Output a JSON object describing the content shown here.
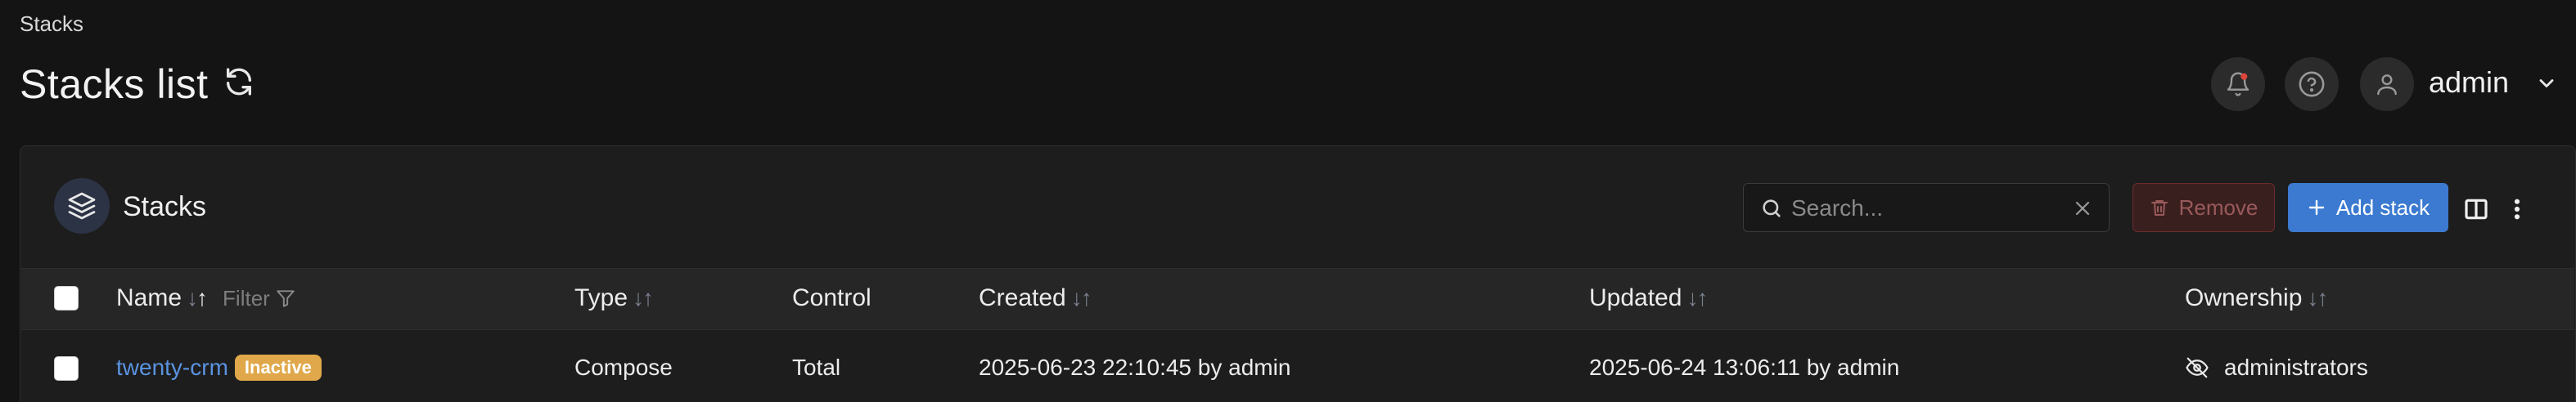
{
  "breadcrumb": "Stacks",
  "header": {
    "title": "Stacks list",
    "user": "admin"
  },
  "panel": {
    "title": "Stacks",
    "search_placeholder": "Search...",
    "remove_label": "Remove",
    "add_label": "Add stack"
  },
  "table": {
    "columns": {
      "name": "Name",
      "filter": "Filter",
      "type": "Type",
      "control": "Control",
      "created": "Created",
      "updated": "Updated",
      "ownership": "Ownership"
    },
    "rows": [
      {
        "name": "twenty-crm",
        "status": "Inactive",
        "type": "Compose",
        "control": "Total",
        "created": "2025-06-23 22:10:45 by admin",
        "updated": "2025-06-24 13:06:11 by admin",
        "ownership": "administrators"
      }
    ]
  },
  "colors": {
    "accent": "#3b7ad0",
    "link": "#5a93e0",
    "badge_inactive": "#e0a84a",
    "danger": "#6a2c2c"
  }
}
